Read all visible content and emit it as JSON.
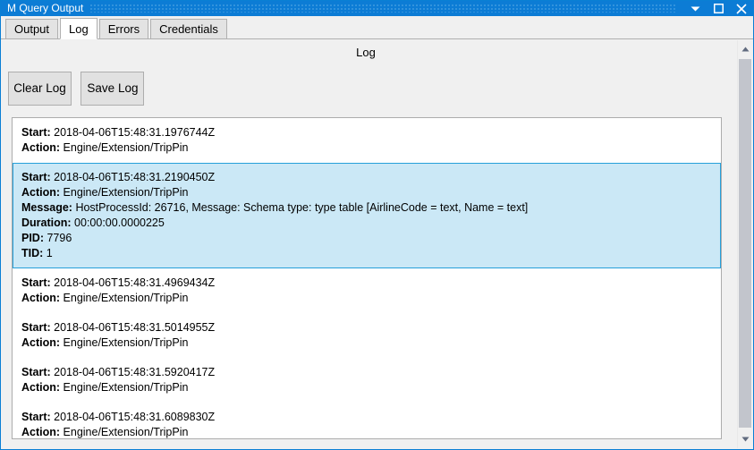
{
  "window": {
    "title": "M Query Output",
    "controls": [
      {
        "name": "minimize",
        "glyph": "chevron-down"
      },
      {
        "name": "maximize",
        "glyph": "square"
      },
      {
        "name": "close",
        "glyph": "cross"
      }
    ]
  },
  "tabs": [
    {
      "label": "Output",
      "active": false
    },
    {
      "label": "Log",
      "active": true
    },
    {
      "label": "Errors",
      "active": false
    },
    {
      "label": "Credentials",
      "active": false
    }
  ],
  "pane": {
    "title": "Log"
  },
  "toolbar": {
    "clear_label": "Clear Log",
    "save_label": "Save Log"
  },
  "log": {
    "entries": [
      {
        "selected": false,
        "fields": [
          {
            "key": "Start:",
            "value": "2018-04-06T15:48:31.1976744Z"
          },
          {
            "key": "Action:",
            "value": "Engine/Extension/TripPin"
          }
        ]
      },
      {
        "selected": true,
        "fields": [
          {
            "key": "Start:",
            "value": "2018-04-06T15:48:31.2190450Z"
          },
          {
            "key": "Action:",
            "value": "Engine/Extension/TripPin"
          },
          {
            "key": "Message:",
            "value": "HostProcessId: 26716, Message: Schema type: type table [AirlineCode = text, Name = text]"
          },
          {
            "key": "Duration:",
            "value": "00:00:00.0000225"
          },
          {
            "key": "PID:",
            "value": "7796"
          },
          {
            "key": "TID:",
            "value": "1"
          }
        ]
      },
      {
        "selected": false,
        "fields": [
          {
            "key": "Start:",
            "value": "2018-04-06T15:48:31.4969434Z"
          },
          {
            "key": "Action:",
            "value": "Engine/Extension/TripPin"
          }
        ]
      },
      {
        "selected": false,
        "fields": [
          {
            "key": "Start:",
            "value": "2018-04-06T15:48:31.5014955Z"
          },
          {
            "key": "Action:",
            "value": "Engine/Extension/TripPin"
          }
        ]
      },
      {
        "selected": false,
        "fields": [
          {
            "key": "Start:",
            "value": "2018-04-06T15:48:31.5920417Z"
          },
          {
            "key": "Action:",
            "value": "Engine/Extension/TripPin"
          }
        ]
      },
      {
        "selected": false,
        "fields": [
          {
            "key": "Start:",
            "value": "2018-04-06T15:48:31.6089830Z"
          },
          {
            "key": "Action:",
            "value": "Engine/Extension/TripPin"
          }
        ]
      }
    ]
  },
  "colors": {
    "titlebar": "#0c7cd5",
    "selection_fill": "#cbe8f6",
    "selection_border": "#26a0da",
    "window_bg": "#f0f0f0",
    "list_bg": "#ffffff",
    "scroll_thumb": "#c2c5cc"
  }
}
